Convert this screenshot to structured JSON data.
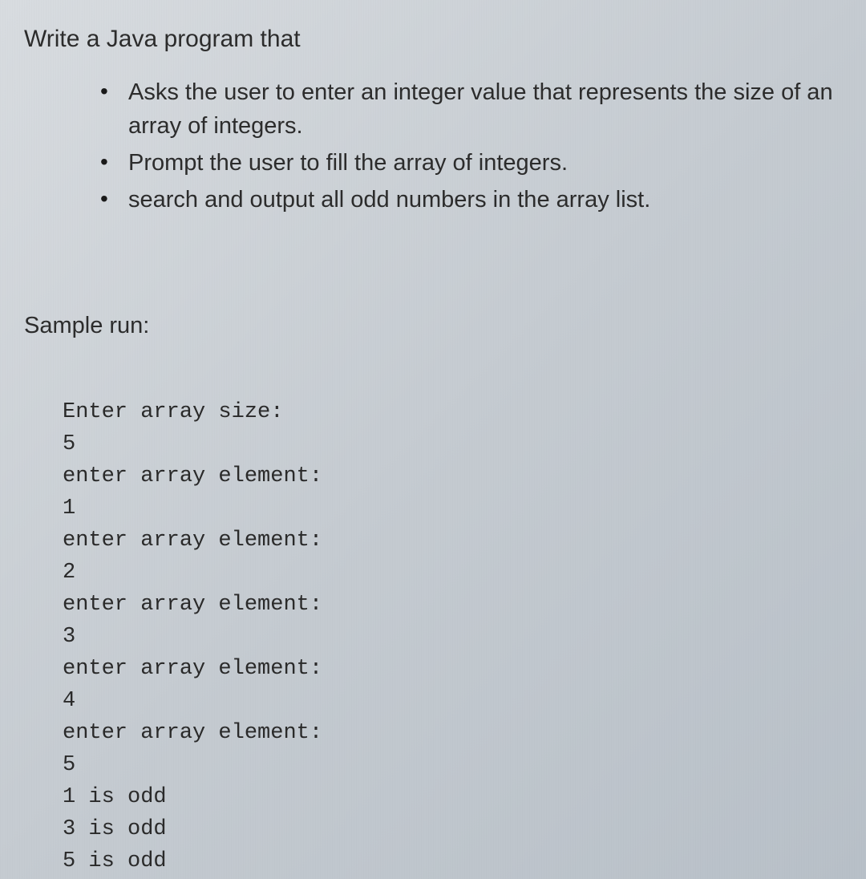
{
  "heading": "Write a Java program that",
  "bullets": [
    "Asks the user to enter an integer value that represents the size of an array of integers.",
    "Prompt the user to fill the array of integers.",
    "search and output all odd numbers in the array list."
  ],
  "sample_heading": "Sample run:",
  "sample_lines": [
    "Enter array size:",
    "5",
    "enter array element:",
    "1",
    "enter array element:",
    "2",
    "enter array element:",
    "3",
    "enter array element:",
    "4",
    "enter array element:",
    "5",
    "1 is odd",
    "3 is odd",
    "5 is odd"
  ]
}
